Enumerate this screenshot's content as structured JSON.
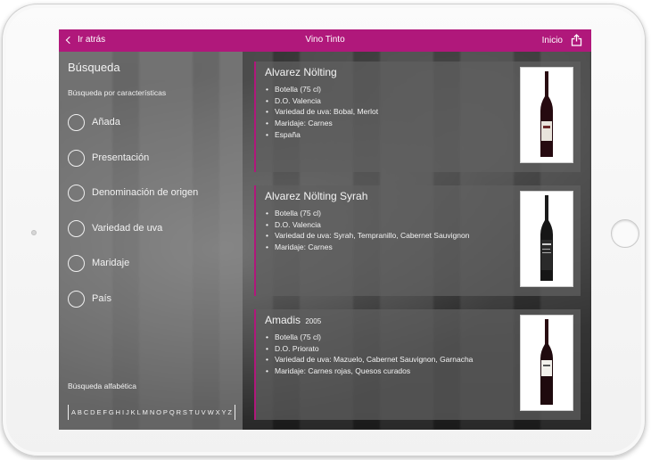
{
  "nav": {
    "back_label": "Ir atrás",
    "title": "Vino Tinto",
    "home_label": "Inicio"
  },
  "sidebar": {
    "title": "Búsqueda",
    "subtitle": "Búsqueda por características",
    "filters": [
      {
        "label": "Añada"
      },
      {
        "label": "Presentación"
      },
      {
        "label": "Denominación de origen"
      },
      {
        "label": "Variedad de uva"
      },
      {
        "label": "Maridaje"
      },
      {
        "label": "País"
      }
    ],
    "alpha_title": "Búsqueda alfabética",
    "alphabet": [
      "A",
      "B",
      "C",
      "D",
      "E",
      "F",
      "G",
      "H",
      "I",
      "J",
      "K",
      "L",
      "M",
      "N",
      "O",
      "P",
      "Q",
      "R",
      "S",
      "T",
      "U",
      "V",
      "W",
      "X",
      "Y",
      "Z"
    ]
  },
  "wines": [
    {
      "name": "Alvarez Nölting",
      "year": "",
      "details": [
        "Botella (75 cl)",
        "D.O. Valencia",
        "Variedad de uva: Bobal, Merlot",
        "Maridaje: Carnes",
        "España"
      ]
    },
    {
      "name": "Alvarez Nölting Syrah",
      "year": "",
      "details": [
        "Botella (75 cl)",
        "D.O. Valencia",
        "Variedad de uva: Syrah, Tempranillo, Cabernet Sauvignon",
        "Maridaje: Carnes"
      ]
    },
    {
      "name": "Amadis",
      "year": "2005",
      "details": [
        "Botella (75 cl)",
        "D.O. Priorato",
        "Variedad de uva: Mazuelo, Cabernet Sauvignon, Garnacha",
        "Maridaje: Carnes rojas, Quesos curados"
      ]
    }
  ],
  "icons": {
    "back": "chevron-left-icon",
    "share": "share-icon",
    "bottle": "wine-bottle-icon"
  },
  "colors": {
    "accent": "#b0187b"
  }
}
